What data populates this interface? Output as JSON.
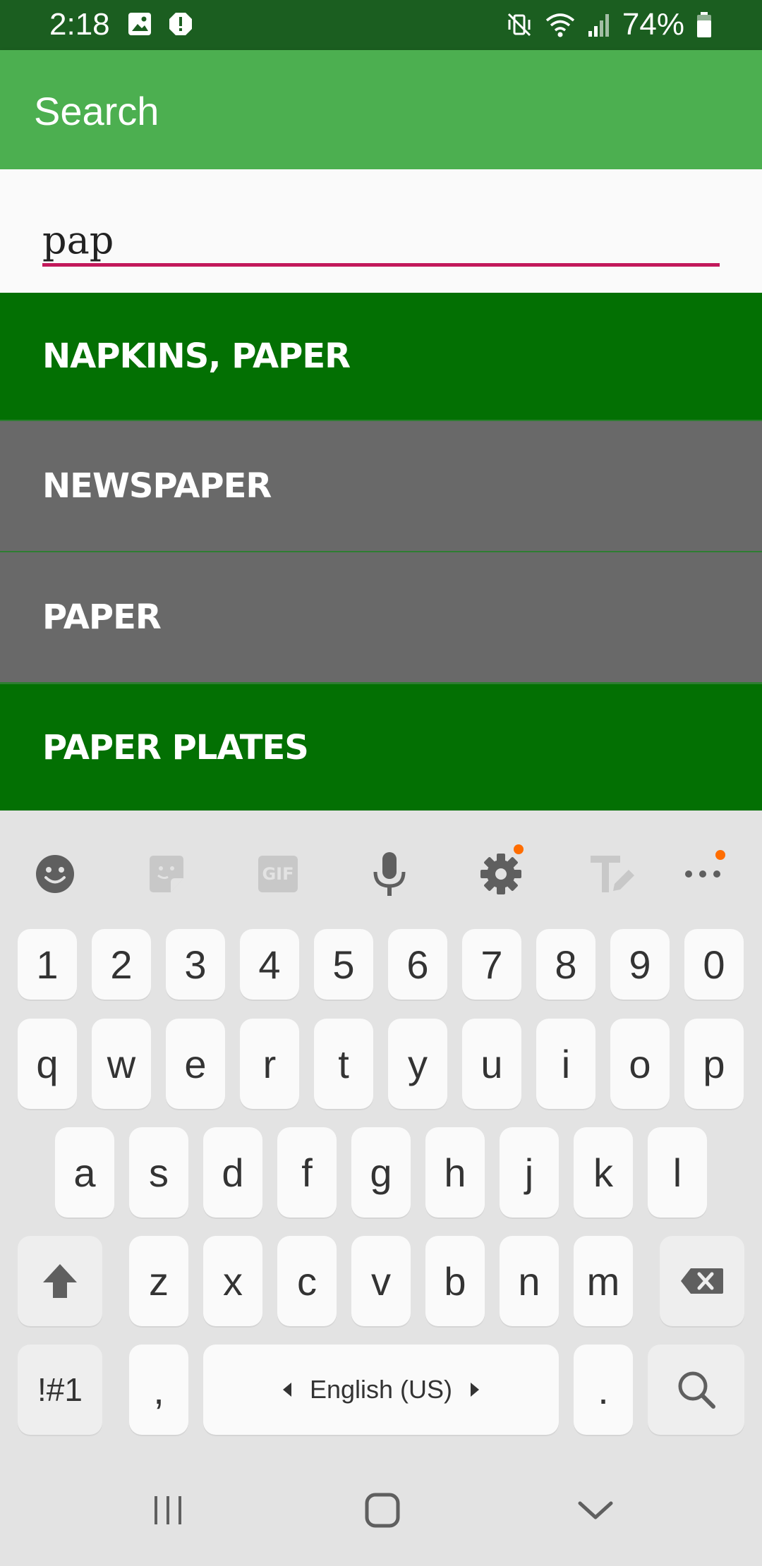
{
  "status": {
    "time": "2:18",
    "battery": "74%"
  },
  "app_bar": {
    "title": "Search"
  },
  "search": {
    "value": "pap"
  },
  "results": [
    {
      "label": "NAPKINS, PAPER",
      "color": "#037003"
    },
    {
      "label": "NEWSPAPER",
      "color": "#696969"
    },
    {
      "label": "PAPER",
      "color": "#696969"
    },
    {
      "label": "PAPER PLATES",
      "color": "#037003"
    }
  ],
  "keyboard": {
    "toolbar_icons": [
      "emoji-icon",
      "sticker-icon",
      "gif-icon",
      "microphone-icon",
      "settings-icon",
      "text-edit-icon",
      "more-icon"
    ],
    "gif_label": "GIF",
    "number_row": [
      "1",
      "2",
      "3",
      "4",
      "5",
      "6",
      "7",
      "8",
      "9",
      "0"
    ],
    "row1": [
      "q",
      "w",
      "e",
      "r",
      "t",
      "y",
      "u",
      "i",
      "o",
      "p"
    ],
    "row2": [
      "a",
      "s",
      "d",
      "f",
      "g",
      "h",
      "j",
      "k",
      "l"
    ],
    "row3": [
      "z",
      "x",
      "c",
      "v",
      "b",
      "n",
      "m"
    ],
    "symbols_label": "!#1",
    "comma_label": ",",
    "space_label": "English (US)",
    "period_label": "."
  },
  "colors": {
    "status_bar": "#1b5e20",
    "app_bar": "#4caf50",
    "accent_underline": "#c2185b",
    "notification_dot": "#ff6d00"
  }
}
